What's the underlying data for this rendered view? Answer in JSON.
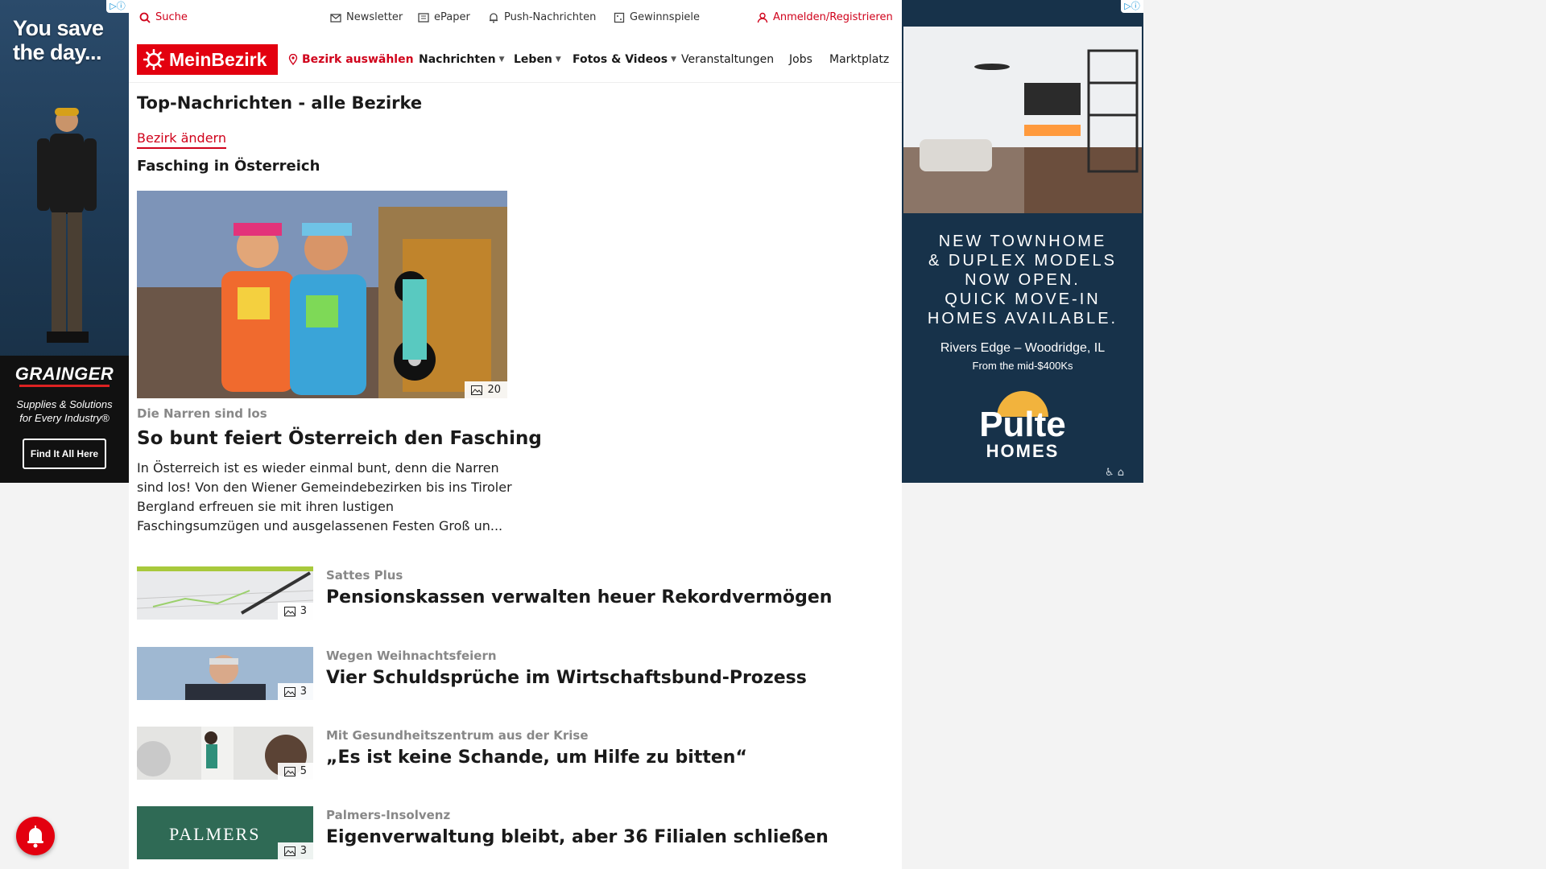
{
  "topbar": {
    "search_label": "Suche",
    "newsletter_label": "Newsletter",
    "epaper_label": "ePaper",
    "push_label": "Push-Nachrichten",
    "gewinnspiele_label": "Gewinnspiele",
    "login_label": "Anmelden/Registrieren"
  },
  "nav": {
    "logo_text": "MeinBezirk",
    "district_label": "Bezirk auswählen",
    "items": [
      {
        "label": "Nachrichten"
      },
      {
        "label": "Leben"
      },
      {
        "label": "Fotos & Videos"
      },
      {
        "label": "Veranstaltungen"
      },
      {
        "label": "Jobs"
      },
      {
        "label": "Marktplatz"
      }
    ]
  },
  "page": {
    "title": "Top-Nachrichten - alle Bezirke",
    "change_district_label": "Bezirk ändern",
    "section_title": "Fasching in Österreich"
  },
  "hero": {
    "photo_count": "20",
    "kicker": "Die Narren sind los",
    "headline": "So bunt feiert Österreich den Fasching",
    "teaser": "In Österreich ist es wieder einmal bunt, denn die Narren sind los! Von den Wiener Gemeindebezirken bis ins Tiroler Bergland erfreuen sie mit ihren lustigen Faschingsumzügen und ausgelassenen Festen Groß un..."
  },
  "articles": [
    {
      "kicker": "Sattes Plus",
      "headline": "Pensionskassen verwalten heuer Rekordvermögen",
      "photo_count": "3"
    },
    {
      "kicker": "Wegen Weihnachtsfeiern",
      "headline": "Vier Schuldsprüche im Wirtschaftsbund-Prozess",
      "photo_count": "3"
    },
    {
      "kicker": "Mit Gesundheitszentrum aus der Krise",
      "headline": "„Es ist keine Schande, um Hilfe zu bitten“",
      "photo_count": "5"
    },
    {
      "kicker": "Palmers-Insolvenz",
      "headline": "Eigenverwaltung bleibt, aber 36 Filialen schließen",
      "photo_count": "3",
      "thumb_text": "PALMERS"
    }
  ],
  "ad_left": {
    "headline_1": "You save",
    "headline_2": "the day...",
    "brand": "GRAINGER",
    "tagline_1": "Supplies & Solutions",
    "tagline_2": "for Every Industry®",
    "cta": "Find It All Here"
  },
  "ad_right": {
    "copy_lines": [
      "NEW TOWNHOME",
      "& DUPLEX MODELS",
      "NOW OPEN.",
      "QUICK MOVE-IN",
      "HOMES AVAILABLE."
    ],
    "location": "Rivers Edge – Woodridge, IL",
    "price": "From the mid-$400Ks",
    "logo_1": "Pulte",
    "logo_2": "HOMES"
  },
  "colors": {
    "brand_red": "#e3000f",
    "link_red": "#d0021b",
    "kicker_gray": "#888888"
  },
  "icons": [
    "search-icon",
    "mail-icon",
    "newspaper-icon",
    "bell-icon",
    "gift-icon",
    "user-icon",
    "location-pin-icon",
    "chevron-down-icon",
    "gallery-icon",
    "notification-bell-icon",
    "adchoices-icon"
  ]
}
